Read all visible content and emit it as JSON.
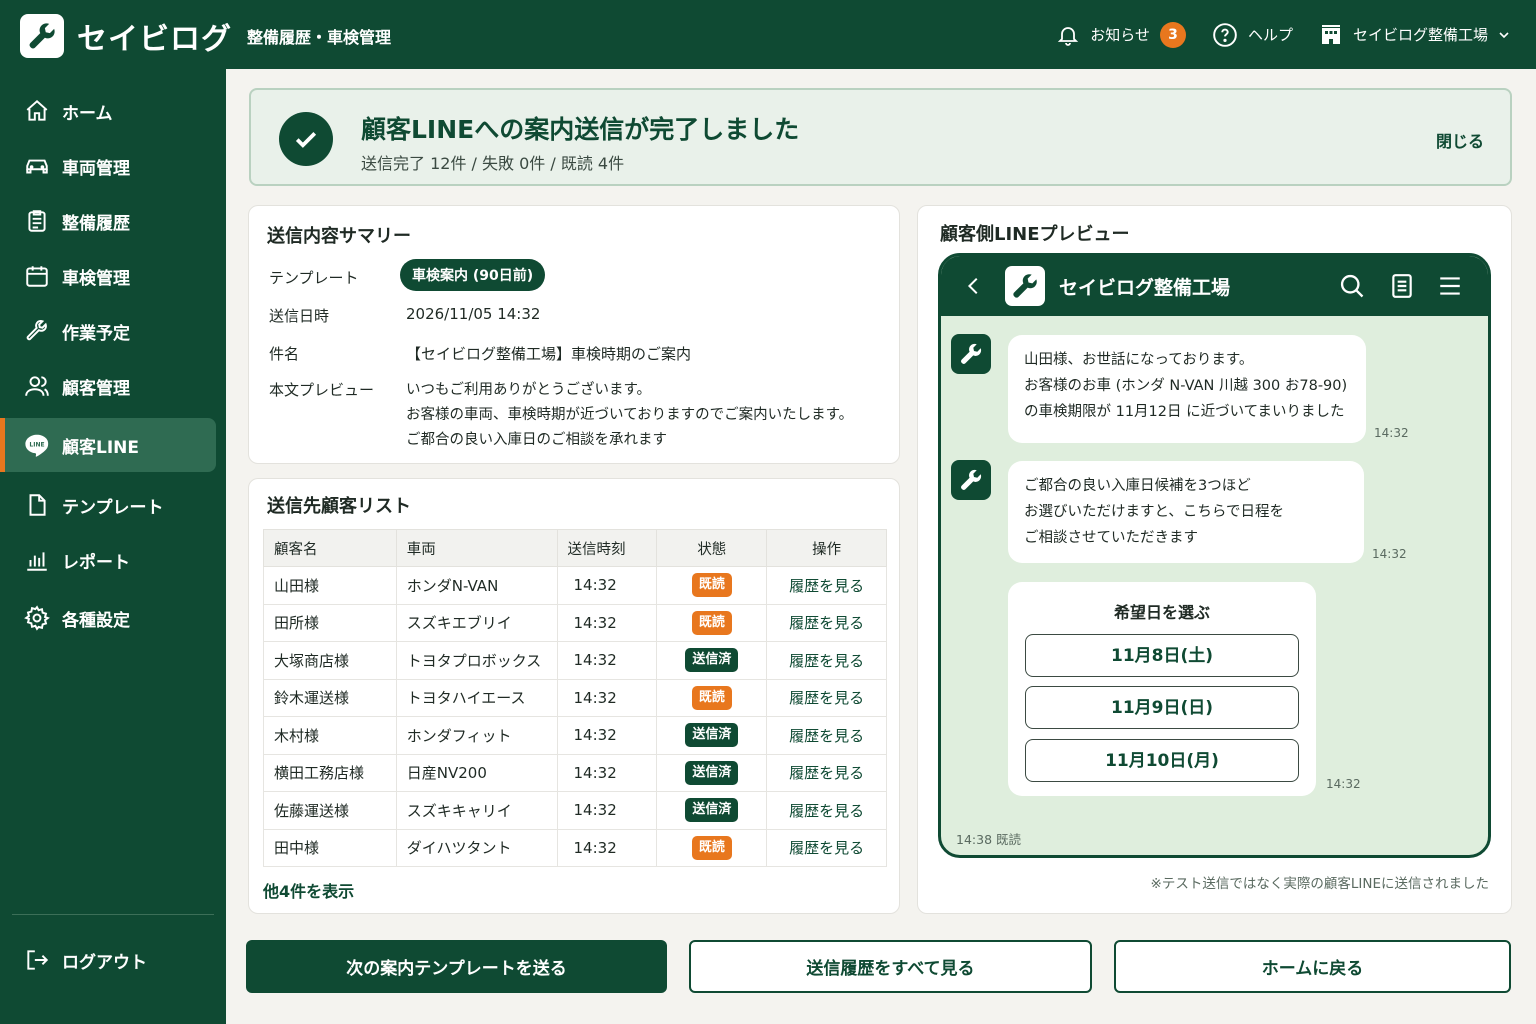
{
  "header": {
    "brand": "セイビログ",
    "subtitle": "整備履歴・車検管理",
    "notifications_label": "お知らせ",
    "notifications_count": "3",
    "help_label": "ヘルプ",
    "shop_label": "セイビログ整備工場"
  },
  "sidebar": {
    "items": [
      {
        "label": "ホーム",
        "icon": "home-icon"
      },
      {
        "label": "車両管理",
        "icon": "car-icon"
      },
      {
        "label": "整備履歴",
        "icon": "clipboard-icon"
      },
      {
        "label": "車検管理",
        "icon": "calendar-icon"
      },
      {
        "label": "作業予定",
        "icon": "wrench-icon"
      },
      {
        "label": "顧客管理",
        "icon": "users-icon"
      },
      {
        "label": "顧客LINE",
        "icon": "line-icon",
        "active": true
      },
      {
        "label": "テンプレート",
        "icon": "file-icon"
      },
      {
        "label": "レポート",
        "icon": "chart-icon"
      },
      {
        "label": "各種設定",
        "icon": "gear-icon"
      }
    ],
    "logout": "ログアウト"
  },
  "banner": {
    "title": "顧客LINEへの案内送信が完了しました",
    "subtitle": "送信完了 12件 / 失敗 0件 / 既読 4件",
    "close": "閉じる"
  },
  "summary": {
    "title": "送信内容サマリー",
    "template_label": "テンプレート",
    "template_value": "車検案内 (90日前)",
    "datetime_label": "送信日時",
    "datetime_value": "2026/11/05 14:32",
    "subject_label": "件名",
    "subject_value": "【セイビログ整備工場】車検時期のご案内",
    "body_label": "本文プレビュー",
    "body_lines": [
      "いつもご利用ありがとうございます。",
      "お客様の車両、車検時期が近づいておりますのでご案内いたします。",
      "ご都合の良い入庫日のご相談を承れます"
    ]
  },
  "recipients": {
    "title": "送信先顧客リスト",
    "columns": [
      "顧客名",
      "車両",
      "送信時刻",
      "状態",
      "操作"
    ],
    "rows": [
      {
        "name": "山田様",
        "vehicle": "ホンダN-VAN",
        "time": "14:32",
        "status": "既読",
        "action": "履歴を見る"
      },
      {
        "name": "田所様",
        "vehicle": "スズキエブリイ",
        "time": "14:32",
        "status": "既読",
        "action": "履歴を見る"
      },
      {
        "name": "大塚商店様",
        "vehicle": "トヨタプロボックス",
        "time": "14:32",
        "status": "送信済",
        "action": "履歴を見る"
      },
      {
        "name": "鈴木運送様",
        "vehicle": "トヨタハイエース",
        "time": "14:32",
        "status": "既読",
        "action": "履歴を見る"
      },
      {
        "name": "木村様",
        "vehicle": "ホンダフィット",
        "time": "14:32",
        "status": "送信済",
        "action": "履歴を見る"
      },
      {
        "name": "横田工務店様",
        "vehicle": "日産NV200",
        "time": "14:32",
        "status": "送信済",
        "action": "履歴を見る"
      },
      {
        "name": "佐藤運送様",
        "vehicle": "スズキキャリイ",
        "time": "14:32",
        "status": "送信済",
        "action": "履歴を見る"
      },
      {
        "name": "田中様",
        "vehicle": "ダイハツタント",
        "time": "14:32",
        "status": "既読",
        "action": "履歴を見る"
      }
    ],
    "more": "他4件を表示"
  },
  "preview": {
    "title": "顧客側LINEプレビュー",
    "shop_name": "セイビログ整備工場",
    "message1": [
      "山田様、お世話になっております。",
      "お客様のお車 (ホンダ N-VAN 川越 300 お78-90)",
      "の車検期限が 11月12日 に近づいてまいりました"
    ],
    "message1_time": "14:32",
    "message2": [
      "ご都合の良い入庫日候補を3つほど",
      "お選びいただけますと、こちらで日程を",
      "ご相談させていただきます"
    ],
    "message2_time": "14:32",
    "picker_title": "希望日を選ぶ",
    "picker_options": [
      "11月8日(土)",
      "11月9日(日)",
      "11月10日(月)"
    ],
    "picker_time": "14:32",
    "read_status": "14:38 既読",
    "note": "※テスト送信ではなく実際の顧客LINEに送信されました"
  },
  "actions": {
    "next_template": "次の案内テンプレートを送る",
    "view_history": "送信履歴をすべて見る",
    "go_home": "ホームに戻る"
  },
  "colors": {
    "primary": "#0f4a33",
    "accent": "#e8771e",
    "sent": "#0f4a33",
    "read": "#e8771e"
  }
}
